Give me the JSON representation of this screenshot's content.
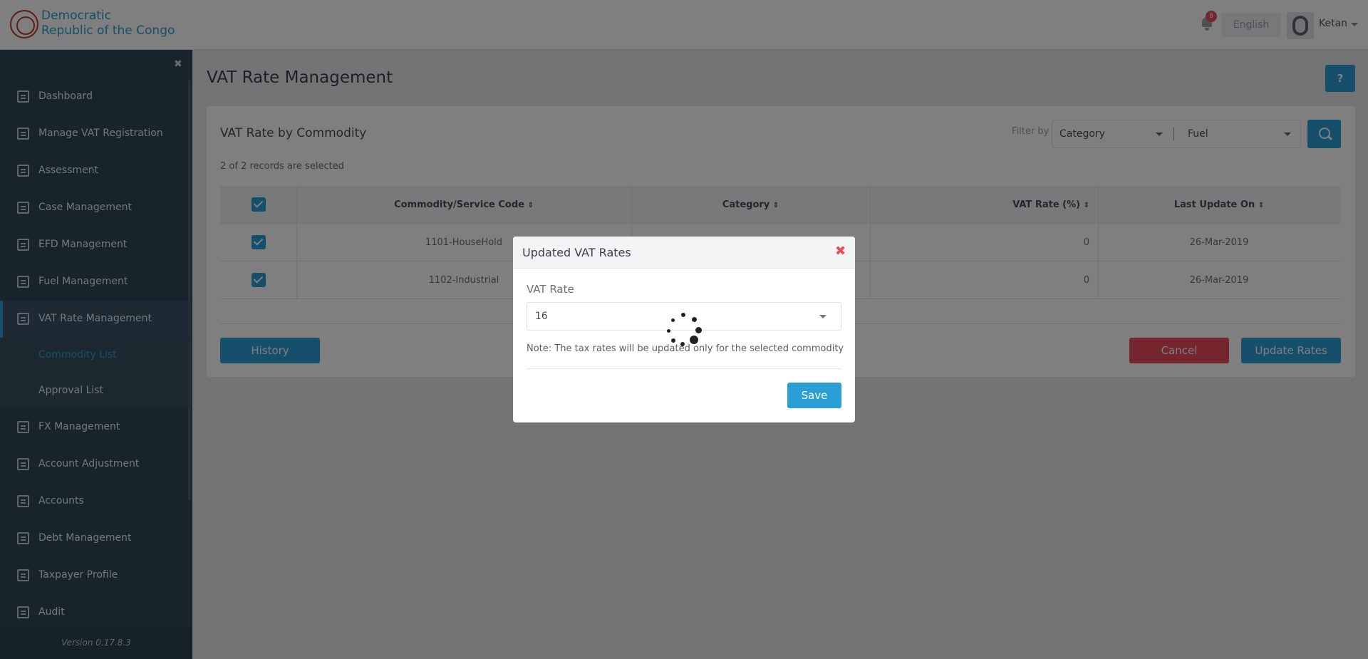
{
  "header": {
    "brand_line1": "Democratic",
    "brand_line2": "Republic of the Congo",
    "notification_count": "8",
    "language": "English",
    "user_name": "Ketan"
  },
  "sidebar": {
    "items": [
      {
        "label": "Dashboard",
        "icon": "dashboard-icon"
      },
      {
        "label": "Manage VAT Registration",
        "icon": "registration-icon"
      },
      {
        "label": "Assessment",
        "icon": "assessment-icon"
      },
      {
        "label": "Case Management",
        "icon": "folder-icon"
      },
      {
        "label": "EFD Management",
        "icon": "device-icon"
      },
      {
        "label": "Fuel Management",
        "icon": "fuel-icon"
      },
      {
        "label": "VAT Rate Management",
        "icon": "vat-rate-icon"
      },
      {
        "label": "FX Management",
        "icon": "fx-icon"
      },
      {
        "label": "Account Adjustment",
        "icon": "document-icon"
      },
      {
        "label": "Accounts",
        "icon": "document-icon"
      },
      {
        "label": "Debt Management",
        "icon": "debt-icon"
      },
      {
        "label": "Taxpayer Profile",
        "icon": "document-icon"
      },
      {
        "label": "Audit",
        "icon": "document-icon"
      }
    ],
    "sub_items": [
      {
        "label": "Commodity List"
      },
      {
        "label": "Approval List"
      }
    ],
    "version": "Version 0.17.8.3"
  },
  "main": {
    "title": "VAT Rate Management",
    "help_label": "?",
    "card_title": "VAT Rate by Commodity",
    "filter_label": "Filter by",
    "filter_category": "Category",
    "filter_value": "Fuel",
    "selected_text": "2 of 2 records are selected",
    "columns": [
      "Commodity/Service Code",
      "Category",
      "VAT Rate (%)",
      "Last Update On"
    ],
    "sort_glyph": "⇕",
    "rows": [
      {
        "code": "1101-HouseHold",
        "category": "",
        "rate": "0",
        "updated": "26-Mar-2019"
      },
      {
        "code": "1102-Industrial",
        "category": "",
        "rate": "0",
        "updated": "26-Mar-2019"
      }
    ],
    "history_label": "History",
    "cancel_label": "Cancel",
    "update_label": "Update Rates"
  },
  "modal": {
    "title": "Updated VAT Rates",
    "close_glyph": "✖",
    "field_label": "VAT Rate",
    "field_value": "16",
    "note": "Note: The tax rates will be updated only for the selected commodity",
    "save_label": "Save"
  },
  "colors": {
    "accent": "#2a9fd6",
    "danger": "#e84b5a",
    "sidebar": "#2f4858"
  }
}
